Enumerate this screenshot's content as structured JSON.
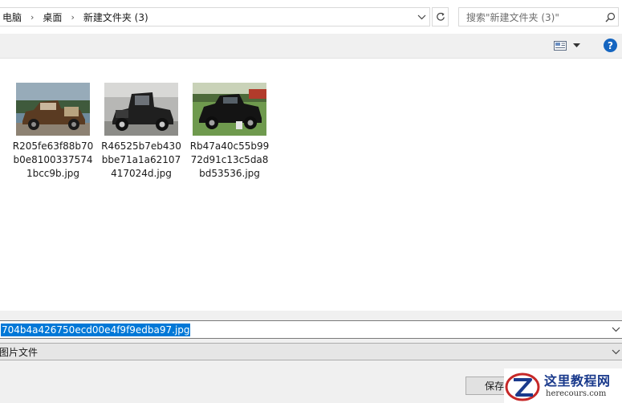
{
  "breadcrumb": {
    "items": [
      "电脑",
      "桌面",
      "新建文件夹 (3)"
    ]
  },
  "search": {
    "placeholder": "搜索\"新建文件夹 (3)\""
  },
  "toolbar": {
    "help_label": "?"
  },
  "files": [
    {
      "name": "R205fe63f88b70b0e81003375741bcc9b.jpg",
      "thumbnail": "brown-vintage-car"
    },
    {
      "name": "R46525b7eb430bbe71a1a62107417024d.jpg",
      "thumbnail": "black-vintage-car"
    },
    {
      "name": "Rb47a40c55b9972d91c13c5da8bd53536.jpg",
      "thumbnail": "dark-vintage-car-on-grass"
    }
  ],
  "save_panel": {
    "filename_value": "704b4a426750ecd00e4f9f9edba97.jpg",
    "filetype_value": "图片文件",
    "save_label": "保存"
  },
  "watermark": {
    "title": "这里教程网",
    "url": "herecours.com"
  },
  "colors": {
    "selection": "#0078d7",
    "help_icon": "#1565c0",
    "panel_bg": "#f0f0f0"
  }
}
